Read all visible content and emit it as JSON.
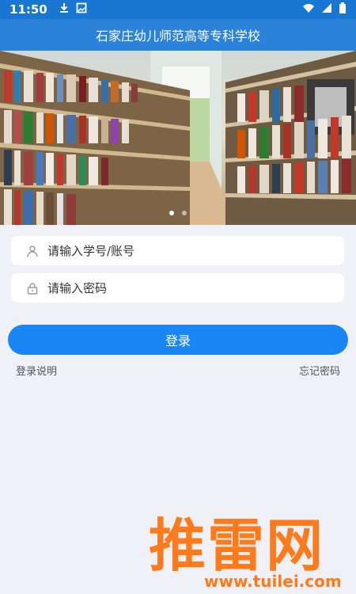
{
  "status_bar": {
    "time": "11:50",
    "icons_left": [
      "download-icon",
      "image-icon"
    ],
    "icons_right": [
      "wifi-icon",
      "signal-icon",
      "battery-icon"
    ]
  },
  "header": {
    "title": "石家庄幼儿师范高等专科学校"
  },
  "banner": {
    "dots": 2,
    "active_dot": 0
  },
  "form": {
    "username_placeholder": "请输入学号/账号",
    "password_placeholder": "请输入密码"
  },
  "actions": {
    "login_label": "登录",
    "login_help": "登录说明",
    "forgot_password": "忘记密码"
  },
  "watermark": {
    "main": "推雷网",
    "url": "www.tuilei.com"
  },
  "colors": {
    "header": "#2b83d9",
    "status": "#1976d2",
    "button": "#1a86f6",
    "background": "#f0f1f7",
    "watermark": "#ff7a1a"
  }
}
